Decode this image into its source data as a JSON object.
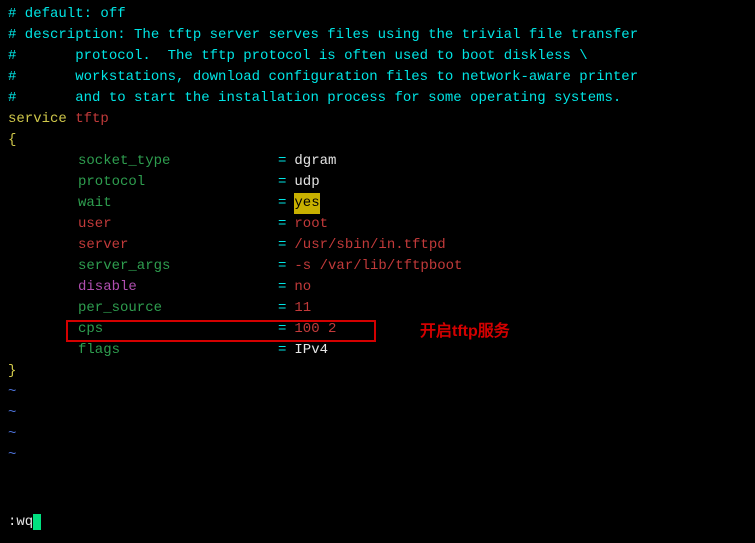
{
  "comments": {
    "l1": "# default: off",
    "l2": "# description: The tftp server serves files using the trivial file transfer",
    "l3_prefix": "#       ",
    "l3": "protocol.  The tftp protocol is often used to boot diskless \\",
    "l4_prefix": "#       ",
    "l4": "workstations, download configuration files to network-aware printer",
    "l5_prefix": "#       ",
    "l5": "and to start the installation process for some operating systems."
  },
  "service_kw": "service",
  "service_name": "tftp",
  "brace_open": "{",
  "brace_close": "}",
  "config": [
    {
      "key": "socket_type",
      "keyColor": "green",
      "eq": "=",
      "val": "dgram",
      "valColor": "white"
    },
    {
      "key": "protocol",
      "keyColor": "green",
      "eq": "=",
      "val": "udp",
      "valColor": "white"
    },
    {
      "key": "wait",
      "keyColor": "green",
      "eq": "=",
      "val": "yes",
      "valColor": "bg-yellow"
    },
    {
      "key": "user",
      "keyColor": "red",
      "eq": "=",
      "val": "root",
      "valColor": "red"
    },
    {
      "key": "server",
      "keyColor": "red",
      "eq": "=",
      "val": "/usr/sbin/in.tftpd",
      "valColor": "red"
    },
    {
      "key": "server_args",
      "keyColor": "green",
      "eq": "=",
      "val": "-s /var/lib/tftpboot",
      "valColor": "red"
    },
    {
      "key": "disable",
      "keyColor": "magenta",
      "eq": "=",
      "val": "no",
      "valColor": "red"
    },
    {
      "key": "per_source",
      "keyColor": "green",
      "eq": "=",
      "val": "11",
      "valColor": "red"
    },
    {
      "key": "cps",
      "keyColor": "green",
      "eq": "=",
      "val": "100 2",
      "valColor": "red"
    },
    {
      "key": "flags",
      "keyColor": "green",
      "eq": "=",
      "val": "IPv4",
      "valColor": "white"
    }
  ],
  "tilde": "~",
  "cmd": ":wq",
  "annotation": "开启tftp服务"
}
